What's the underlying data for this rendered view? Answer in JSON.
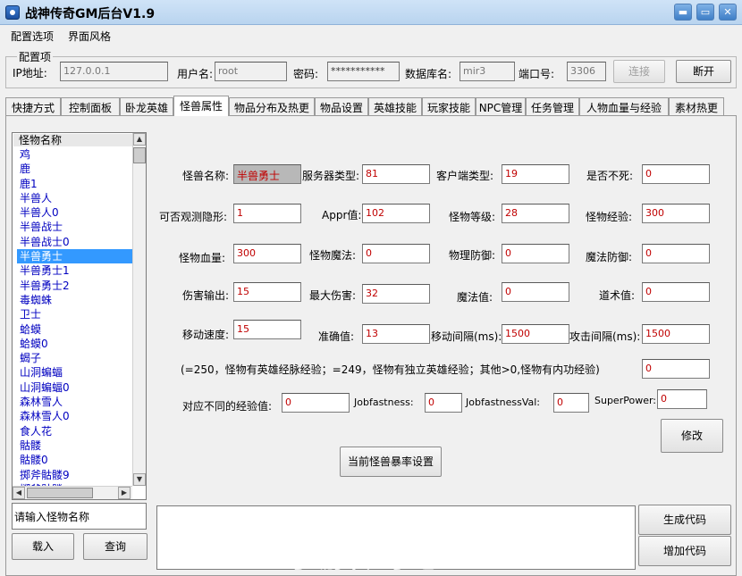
{
  "window": {
    "title": "战神传奇GM后台V1.9",
    "min_label": "▬",
    "max_label": "▭",
    "close_label": "✕"
  },
  "menu": {
    "config": "配置选项",
    "style": "界面风格"
  },
  "config": {
    "legend": "配置项",
    "ip_label": "IP地址:",
    "ip_value": "127.0.0.1",
    "user_label": "用户名:",
    "user_value": "root",
    "pwd_label": "密码:",
    "pwd_value": "***********",
    "db_label": "数据库名:",
    "db_value": "mir3",
    "port_label": "端口号:",
    "port_value": "3306",
    "connect_label": "连接",
    "disconnect_label": "断开"
  },
  "tabs": [
    "快捷方式",
    "控制面板",
    "卧龙英雄",
    "怪兽属性",
    "物品分布及热更",
    "物品设置",
    "英雄技能",
    "玩家技能",
    "NPC管理",
    "任务管理",
    "人物血量与经验",
    "素材热更"
  ],
  "monster_list": {
    "header": "怪物名称",
    "items": [
      "鸡",
      "鹿",
      "鹿1",
      "半兽人",
      "半兽人0",
      "半兽战士",
      "半兽战士0",
      "半兽勇士",
      "半兽勇士1",
      "半兽勇士2",
      "毒蜘蛛",
      "卫士",
      "蛤蟆",
      "蛤蟆0",
      "蝎子",
      "山洞蝙蝠",
      "山洞蝙蝠0",
      "森林雪人",
      "森林雪人0",
      "食人花",
      "骷髅",
      "骷髅0",
      "掷斧骷髅9",
      "掷斧骷髅"
    ],
    "selected_index": 7,
    "search_placeholder": "请输入怪物名称",
    "load_label": "载入",
    "query_label": "查询"
  },
  "form": {
    "name_label": "怪兽名称:",
    "name_value": "半兽勇士",
    "server_type_label": "服务器类型:",
    "server_type_value": "81",
    "client_type_label": "客户端类型:",
    "client_type_value": "19",
    "undead_label": "是否不死:",
    "undead_value": "0",
    "stealth_label": "可否观测隐形:",
    "stealth_value": "1",
    "appr_label": "Appr值:",
    "appr_value": "102",
    "level_label": "怪物等级:",
    "level_value": "28",
    "exp_label": "怪物经验:",
    "exp_value": "300",
    "hp_label": "怪物血量:",
    "hp_value": "300",
    "mp_label": "怪物魔法:",
    "mp_value": "0",
    "def_label": "物理防御:",
    "def_value": "0",
    "mdef_label": "魔法防御:",
    "mdef_value": "0",
    "dmg_label": "伤害输出:",
    "dmg_value": "15",
    "maxdmg_label": "最大伤害:",
    "maxdmg_value": "32",
    "magic_label": "魔法值:",
    "magic_value": "0",
    "tao_label": "道术值:",
    "tao_value": "0",
    "speed_label": "移动速度:",
    "speed_value": "15",
    "acc_label": "准确值:",
    "acc_value": "13",
    "move_int_label": "移动间隔(ms):",
    "move_int_value": "1500",
    "atk_int_label": "攻击间隔(ms):",
    "atk_int_value": "1500",
    "note": "(=250，怪物有英雄经脉经验；=249，怪物有独立英雄经验；其他>0,怪物有内功经验)",
    "note_value": "0",
    "diffexp_label": "对应不同的经验值:",
    "diffexp_value": "0",
    "jobfast_label": "Jobfastness:",
    "jobfast_value": "0",
    "jobfastval_label": "JobfastnessVal:",
    "jobfastval_value": "0",
    "superpower_label": "SuperPower:",
    "superpower_value": "0",
    "modify_label": "修改",
    "drop_label": "当前怪兽暴率设置"
  },
  "actions": {
    "gen_label": "生成代码",
    "add_label": "增加代码"
  },
  "watermark": "手游传奇吧"
}
